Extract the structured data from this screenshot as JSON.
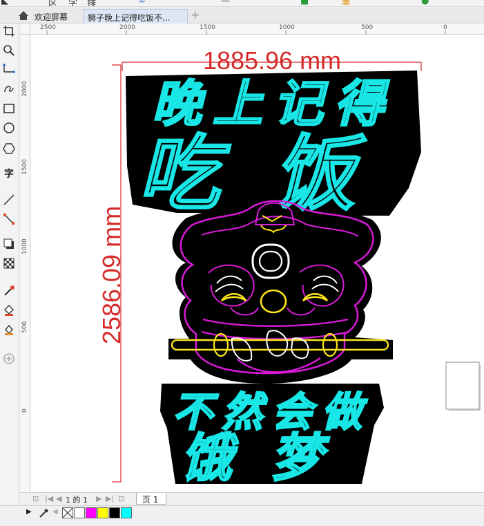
{
  "tabs": {
    "welcome": "欢迎屏幕",
    "document": "狮子晚上记得吃饭不...",
    "add": "+"
  },
  "toolbar": {
    "partial_labels": [
      "区",
      "字",
      "排"
    ]
  },
  "ruler": {
    "h_labels": [
      "2500",
      "2000",
      "1500",
      "1000",
      "500",
      "0"
    ],
    "v_labels": [
      "2000",
      "1500",
      "1000",
      "500",
      "0"
    ]
  },
  "artwork": {
    "dim_width": "1885.96 mm",
    "dim_height": "2586.09 mm",
    "line1": "晚上记得",
    "line2": "吃饭",
    "line3": "不然会做",
    "line4": "饿梦"
  },
  "pagebar": {
    "page_count": "1 的 1",
    "page_tab": "页 1"
  },
  "palette": {
    "colors": [
      "#ffffff",
      "#ff00ff",
      "#ffff00",
      "#000000",
      "#00ffff"
    ]
  },
  "accent": {
    "dimension": "#d52b2b",
    "neon_cyan": "#19e6e6",
    "neon_magenta": "#d81ad8",
    "neon_yellow": "#ffe81a"
  }
}
